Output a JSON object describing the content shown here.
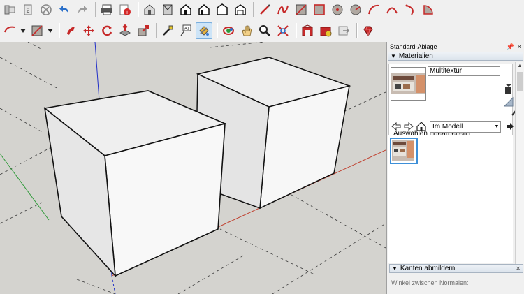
{
  "toolbar": {
    "row1_icons": [
      "select-icon",
      "eraser-small-icon",
      "circle-stop-icon",
      "undo-icon",
      "redo-icon",
      "print-icon",
      "model-info-icon",
      "iso-view-icon",
      "top-view-icon",
      "front-view-icon",
      "right-view-icon",
      "back-view-icon",
      "left-view-icon",
      "pencil-line-icon",
      "freehand-icon",
      "rectangle-icon",
      "rotated-rectangle-icon",
      "circle-icon",
      "polygon-icon",
      "arc-icon",
      "two-point-arc-icon",
      "three-point-arc-icon",
      "pie-icon"
    ],
    "row2_icons": [
      "select-arrow-icon",
      "paint-bucket-icon",
      "move-icon",
      "rotate-icon",
      "push-pull-icon",
      "scale-icon",
      "tape-measure-icon",
      "text-label-icon",
      "paint-active-icon",
      "orbit-icon",
      "pan-hand-icon",
      "zoom-icon",
      "zoom-extents-icon",
      "warehouse-icon",
      "extension-store-icon",
      "share-model-icon",
      "ruby-icon"
    ],
    "active_tool": "paint-active-icon"
  },
  "panel": {
    "title": "Standard-Ablage",
    "pin_label": "📌",
    "close_label": "×",
    "materials": {
      "header": "Materialien",
      "material_name": "Multitextur",
      "tabs": [
        "Auswählen",
        "Bearbeiten"
      ],
      "library": "Im Modell"
    },
    "kanten": {
      "header": "Kanten abmildern",
      "subtitle": "Winkel zwischen Normalen:",
      "faded_text": "- - - - - - -"
    }
  },
  "colors": {
    "ground": "#d4d3cf",
    "sky": "#e9e9e9",
    "cube_top": "#f3f3f3",
    "cube_front": "#ebebeb",
    "cube_side": "#f8f8f8",
    "axis_blue": "#2230c8",
    "axis_red": "#c0402f",
    "axis_green": "#2f9a3a"
  }
}
